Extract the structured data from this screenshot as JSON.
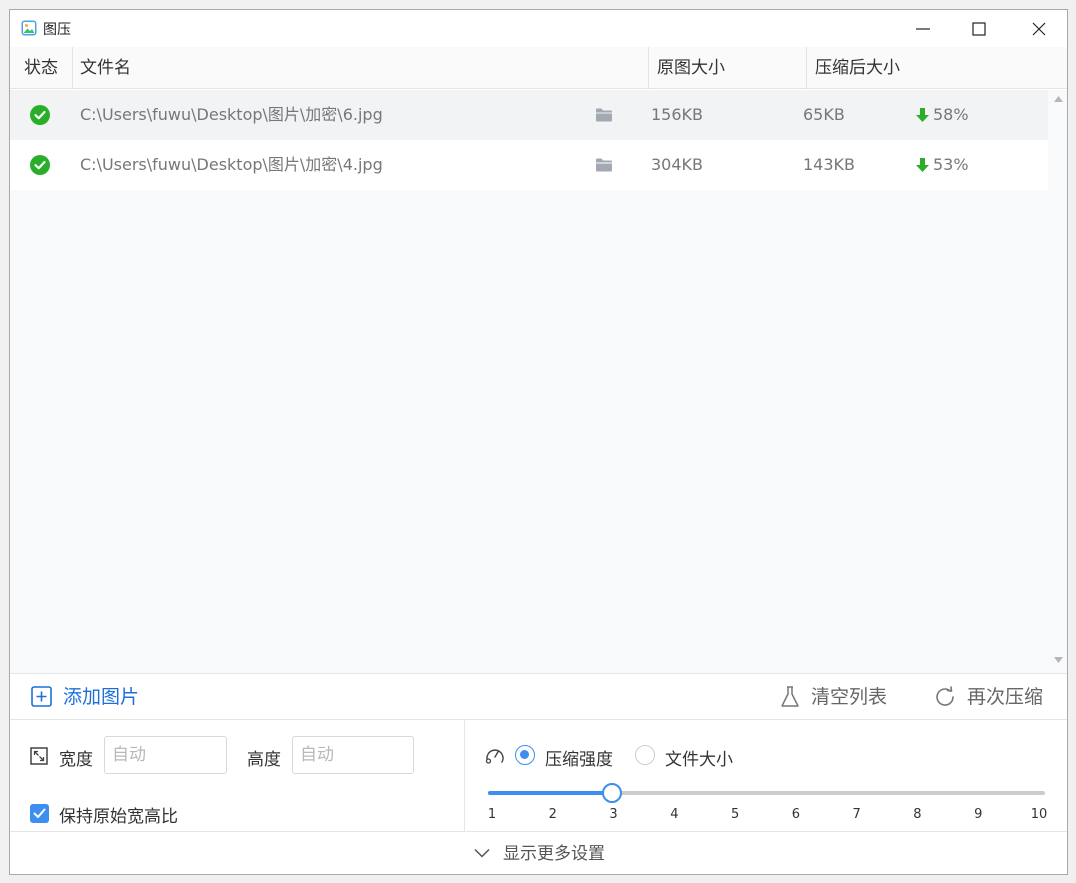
{
  "window": {
    "title": "图压"
  },
  "table": {
    "columns": [
      "状态",
      "文件名",
      "原图大小",
      "压缩后大小"
    ],
    "rows": [
      {
        "status": "success",
        "filename": "C:\\Users\\fuwu\\Desktop\\图片\\加密\\6.jpg",
        "original_size": "156KB",
        "compressed_size": "65KB",
        "reduction": "58%"
      },
      {
        "status": "success",
        "filename": "C:\\Users\\fuwu\\Desktop\\图片\\加密\\4.jpg",
        "original_size": "304KB",
        "compressed_size": "143KB",
        "reduction": "53%"
      }
    ]
  },
  "actions": {
    "add": "添加图片",
    "clear": "清空列表",
    "recompress": "再次压缩"
  },
  "settings": {
    "width_label": "宽度",
    "width_value": "",
    "width_placeholder": "自动",
    "height_label": "高度",
    "height_value": "",
    "height_placeholder": "自动",
    "keep_ratio_label": "保持原始宽高比",
    "keep_ratio_checked": true,
    "mode_options": [
      "压缩强度",
      "文件大小"
    ],
    "mode_selected": "压缩强度",
    "strength_ticks": [
      "1",
      "2",
      "3",
      "4",
      "5",
      "6",
      "7",
      "8",
      "9",
      "10"
    ],
    "strength_value": 3,
    "strength_min": 1,
    "strength_max": 10
  },
  "footer": {
    "more_settings": "显示更多设置"
  },
  "colors": {
    "accent": "#3d8ef0",
    "link": "#1e6fd9",
    "success": "#2aae2a"
  },
  "icons": {
    "app": "image-app-icon",
    "status": "check-circle-icon",
    "folder": "folder-icon",
    "reduction": "arrow-down-icon",
    "add": "plus-square-icon",
    "clear": "flask-icon",
    "recompress": "refresh-icon",
    "resize": "resize-icon",
    "mode": "gauge-icon",
    "footer": "chevron-down-icon"
  }
}
